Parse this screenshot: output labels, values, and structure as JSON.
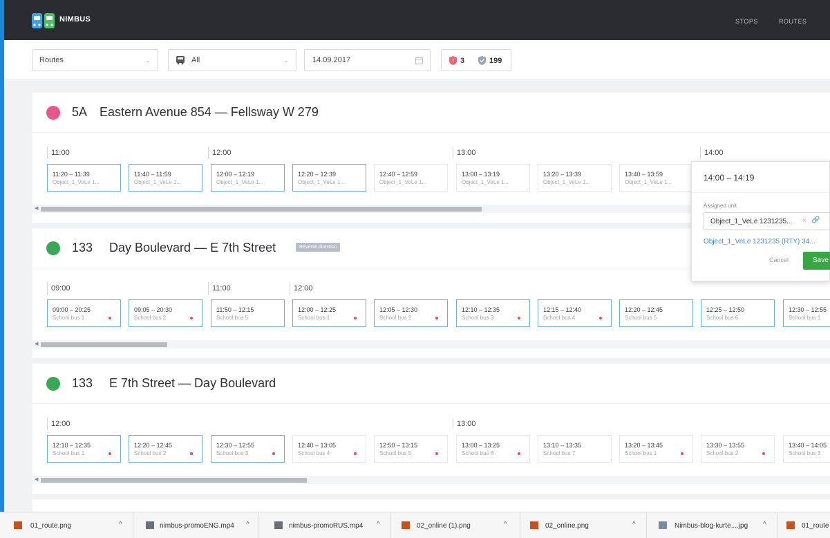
{
  "header": {
    "brand": "NIMBUS",
    "nav": [
      "STOPS",
      "ROUTES"
    ]
  },
  "filters": {
    "routes_value": "Routes",
    "vehicle_value": "All",
    "date_value": "14.09.2017",
    "badge_red_count": "3",
    "badge_shield_count": "199"
  },
  "routes": [
    {
      "number": "5A",
      "name": "Eastern Avenue 854 — Fellsway W 279",
      "icon_color": "#e8568e",
      "hours": [
        "11:00",
        "12:00",
        "13:00",
        "14:00"
      ],
      "trips": [
        {
          "time": "11:20 – 11:39",
          "unit": "Object_1_VeLe 1...",
          "active": true,
          "dot": false
        },
        {
          "time": "11:40 – 11:59",
          "unit": "Object_1_VeLe 1...",
          "active": true,
          "dot": false
        },
        {
          "time": "12:00 – 12:19",
          "unit": "Object_1_VeLe 1...",
          "active": true,
          "dot": false
        },
        {
          "time": "12:20 – 12:39",
          "unit": "Object_1_VeLe 1...",
          "active": true,
          "dot": false
        },
        {
          "time": "12:40 – 12:59",
          "unit": "Object_1_VeLe 1...",
          "active": false,
          "dot": false
        },
        {
          "time": "13:00 – 13:19",
          "unit": "Object_1_VeLe 1...",
          "active": false,
          "dot": false
        },
        {
          "time": "13:20 – 13:39",
          "unit": "Object_1_VeLe 1...",
          "active": false,
          "dot": false
        },
        {
          "time": "13:40 – 13:59",
          "unit": "Object_1_VeLe 1...",
          "active": false,
          "dot": false
        }
      ]
    },
    {
      "number": "133",
      "name": "Day Boulevard — E 7th Street",
      "reverse_tag": "Reverse direction",
      "icon_color": "#3aa757",
      "hours": [
        "09:00",
        "11:00",
        "12:00"
      ],
      "trips": [
        {
          "time": "09:00 – 20:25",
          "unit": "School bus 1",
          "active": true,
          "dot": true
        },
        {
          "time": "09:05 – 20:30",
          "unit": "School bus 2",
          "active": true,
          "dot": true
        },
        {
          "time": "11:50 – 12:15",
          "unit": "School bus 5",
          "active": true,
          "dot": false
        },
        {
          "time": "12:00 – 12:25",
          "unit": "School bus 1",
          "active": true,
          "dot": true
        },
        {
          "time": "12:05 – 12:30",
          "unit": "School bus 2",
          "active": true,
          "dot": true
        },
        {
          "time": "12:10 – 12:35",
          "unit": "School bus 3",
          "active": true,
          "dot": true
        },
        {
          "time": "12:15 – 12:40",
          "unit": "School bus 4",
          "active": true,
          "dot": true
        },
        {
          "time": "12:20 – 12:45",
          "unit": "School bus 5",
          "active": true,
          "dot": false
        },
        {
          "time": "12:25 – 12:50",
          "unit": "School bus 6",
          "active": true,
          "dot": false
        },
        {
          "time": "12:30 – 12:55",
          "unit": "School bus 1",
          "active": true,
          "dot": false
        }
      ]
    },
    {
      "number": "133",
      "name": "E 7th Street — Day Boulevard",
      "icon_color": "#3aa757",
      "hours": [
        "12:00",
        "13:00"
      ],
      "trips": [
        {
          "time": "12:10 – 12:35",
          "unit": "School bus 1",
          "active": true,
          "dot": true
        },
        {
          "time": "12:20 – 12:45",
          "unit": "School bus 2",
          "active": true,
          "dot": true
        },
        {
          "time": "12:30 – 12:55",
          "unit": "School bus 3",
          "active": true,
          "dot": true
        },
        {
          "time": "12:40 – 13:05",
          "unit": "School bus 4",
          "active": false,
          "dot": true
        },
        {
          "time": "12:50 – 13:15",
          "unit": "School bus 5",
          "active": false,
          "dot": true
        },
        {
          "time": "13:00 – 13:25",
          "unit": "School bus 6",
          "active": false,
          "dot": true
        },
        {
          "time": "13:10 – 13:35",
          "unit": "School bus 7",
          "active": false,
          "dot": false
        },
        {
          "time": "13:20 – 13:45",
          "unit": "School bus 1",
          "active": false,
          "dot": true
        },
        {
          "time": "13:30 – 13:55",
          "unit": "School bus 2",
          "active": false,
          "dot": true
        },
        {
          "time": "13:40 – 14:05",
          "unit": "School bus 3",
          "active": false,
          "dot": false
        }
      ]
    }
  ],
  "popover": {
    "title": "14:00 – 14:19",
    "label": "Assigned unit",
    "input_value": "Object_1_VeLe 1231235...",
    "option": "Object_1_VeLe 1231235 (RTY) 34...",
    "cancel": "Cancel",
    "save": "Save"
  },
  "downloads": [
    {
      "name": "01_route.png",
      "type": "image"
    },
    {
      "name": "nimbus-promoENG.mp4",
      "type": "video"
    },
    {
      "name": "nimbus-promoRUS.mp4",
      "type": "video"
    },
    {
      "name": "02_online (1).png",
      "type": "image"
    },
    {
      "name": "02_online.png",
      "type": "image"
    },
    {
      "name": "Nimbus-blog-kurte....jpg",
      "type": "jpg"
    },
    {
      "name": "01_route",
      "type": "image"
    }
  ],
  "colors": {
    "accent": "#37a744",
    "link": "#3b8ad1",
    "header_bg": "#2b2c31",
    "frame": "#1e88d8"
  }
}
